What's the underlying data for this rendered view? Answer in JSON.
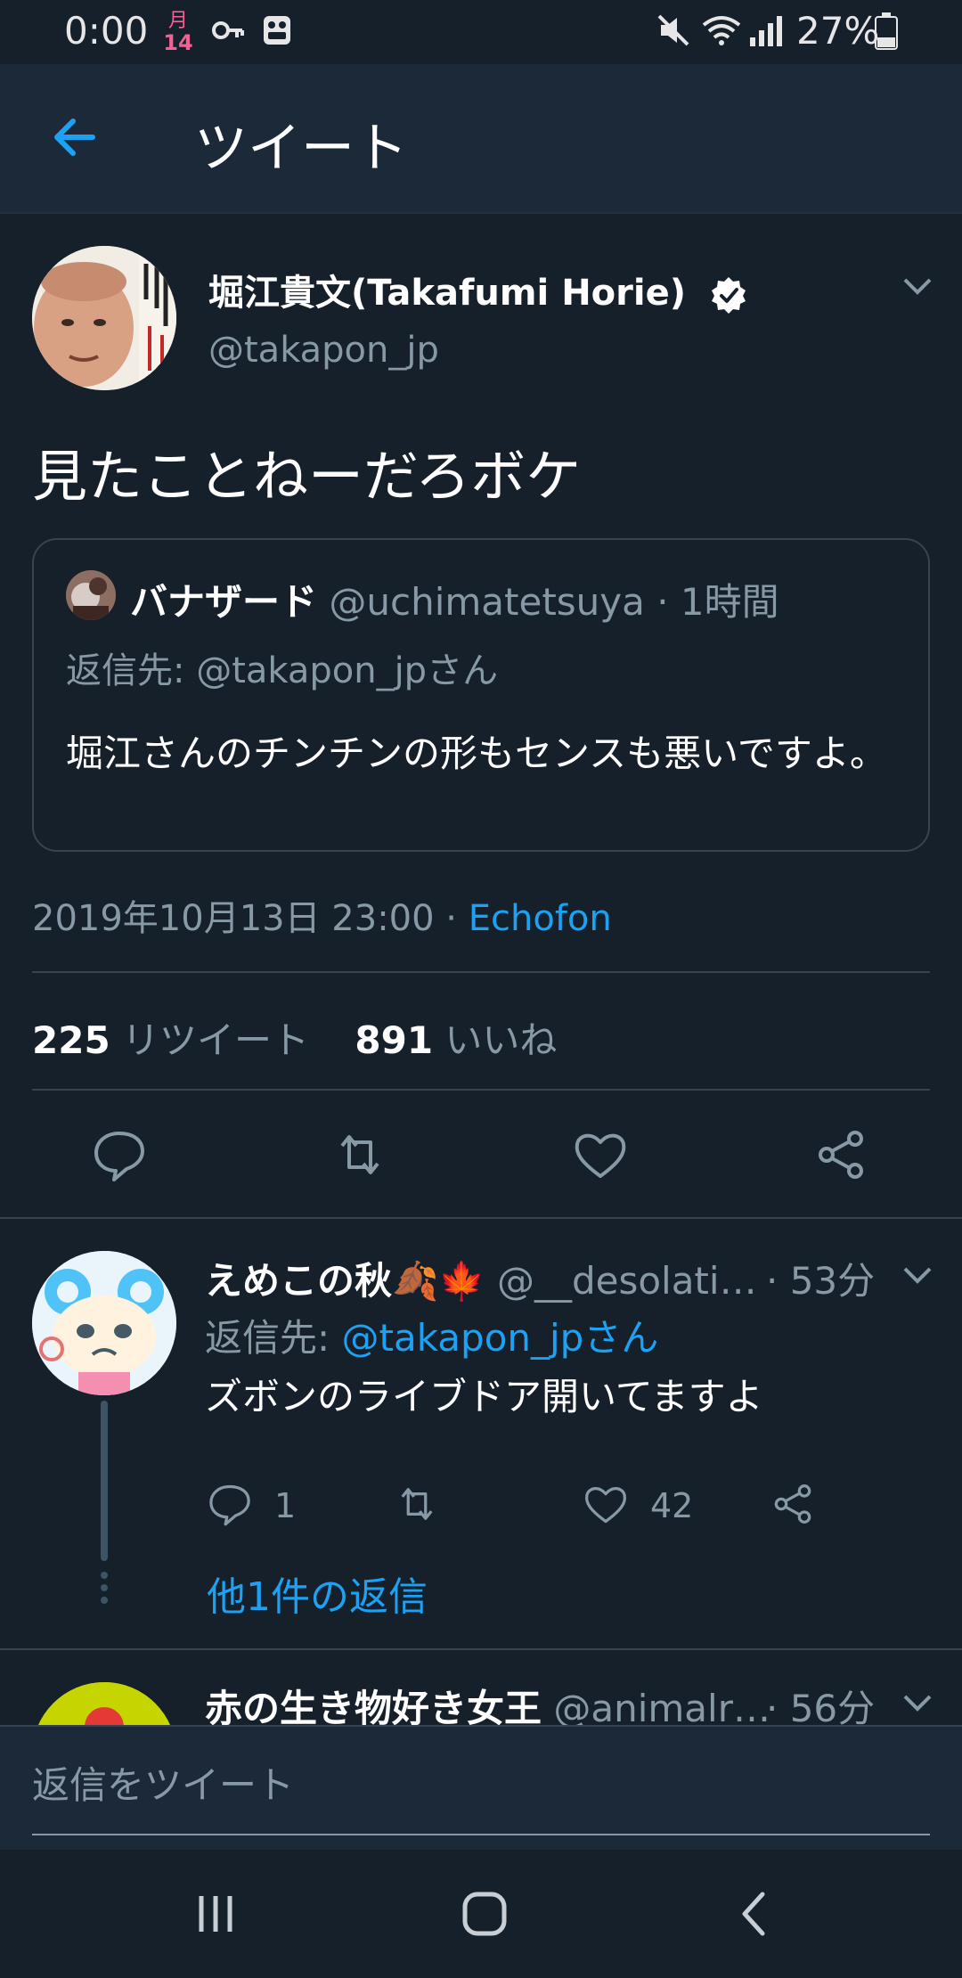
{
  "status_bar": {
    "time": "0:00",
    "date_month": "月",
    "date_day": "14",
    "battery": "27%"
  },
  "header": {
    "title": "ツイート"
  },
  "tweet": {
    "author_name": "堀江貴文(Takafumi Horie)",
    "author_handle": "@takapon_jp",
    "text": "見たことねーだろボケ",
    "quote": {
      "name": "バナザード",
      "meta": " @uchimatetsuya · 1時間",
      "reply_to": "返信先: @takapon_jpさん",
      "text": "堀江さんのチンチンの形もセンスも悪いですよ。"
    },
    "timestamp": "2019年10月13日 23:00 · ",
    "source": "Echofon",
    "retweet_count": "225",
    "retweet_label": " リツイート",
    "like_count": "891",
    "like_label": " いいね"
  },
  "replies": [
    {
      "name": "えめこの秋🍂🍁",
      "handle": " @__desolati…",
      "time": "· 53分",
      "reply_to_prefix": "返信先: ",
      "reply_to_mention": "@takapon_jpさん",
      "text": "ズボンのライブドア開いてますよ",
      "reply_count": "1",
      "like_count": "42",
      "more_replies": "他1件の返信"
    },
    {
      "name": "赤の生き物好き女王",
      "handle": " @animalr…",
      "time": "· 56分"
    }
  ],
  "composer": {
    "placeholder": "返信をツイート"
  },
  "colors": {
    "background": "#15202b",
    "accent": "#1da1f2",
    "secondary_text": "#8899a6",
    "border": "#38444d"
  }
}
